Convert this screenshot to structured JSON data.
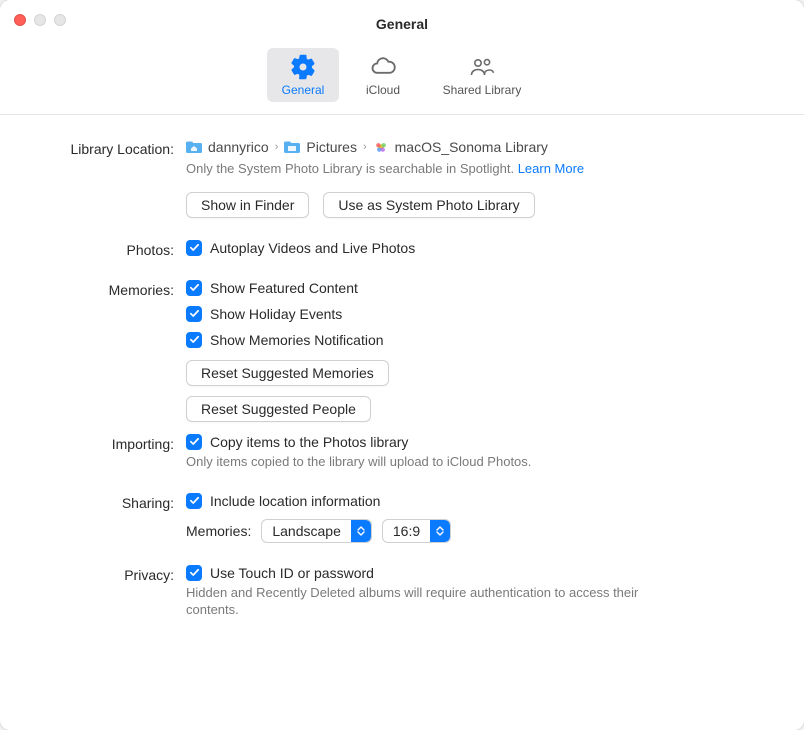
{
  "window": {
    "title": "General"
  },
  "toolbar": {
    "general": "General",
    "icloud": "iCloud",
    "shared_library": "Shared Library"
  },
  "library": {
    "label": "Library Location:",
    "path": [
      "dannyrico",
      "Pictures",
      "macOS_Sonoma Library"
    ],
    "note": "Only the System Photo Library is searchable in Spotlight.",
    "learn_more": "Learn More",
    "show_in_finder": "Show in Finder",
    "use_system": "Use as System Photo Library"
  },
  "photos": {
    "label": "Photos:",
    "autoplay": "Autoplay Videos and Live Photos"
  },
  "memories": {
    "label": "Memories:",
    "featured": "Show Featured Content",
    "holiday": "Show Holiday Events",
    "notification": "Show Memories Notification",
    "reset_memories": "Reset Suggested Memories",
    "reset_people": "Reset Suggested People"
  },
  "importing": {
    "label": "Importing:",
    "copy": "Copy items to the Photos library",
    "note": "Only items copied to the library will upload to iCloud Photos."
  },
  "sharing": {
    "label": "Sharing:",
    "location": "Include location information",
    "memories_label": "Memories:",
    "orientation": "Landscape",
    "aspect": "16:9"
  },
  "privacy": {
    "label": "Privacy:",
    "touchid": "Use Touch ID or password",
    "note": "Hidden and Recently Deleted albums will require authentication to access their contents."
  }
}
